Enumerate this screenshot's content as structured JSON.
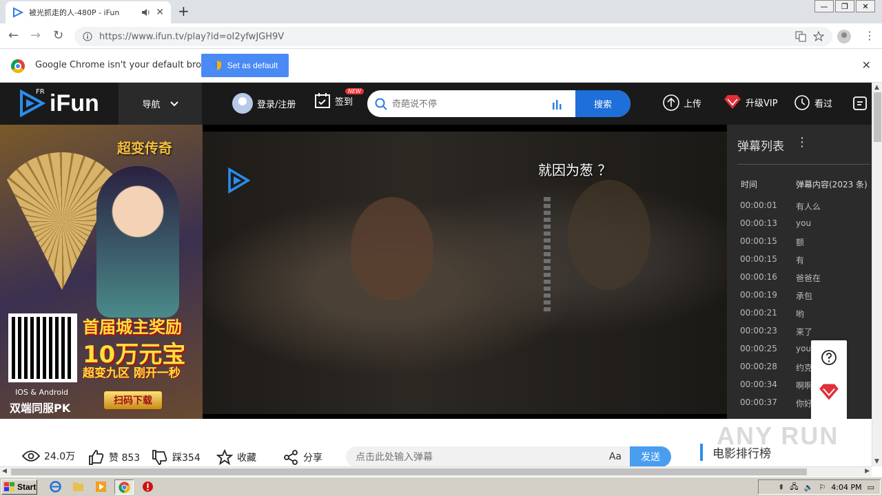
{
  "browser": {
    "tab_title": "被光抓走的人-480P - iFun",
    "tab_close": "✕",
    "new_tab": "+",
    "url": "https://www.ifun.tv/play?id=oI2yfwJGH9V",
    "win_min": "—",
    "win_max": "❐",
    "win_close": "✕"
  },
  "infobar": {
    "message": "Google Chrome isn't your default browser",
    "button": "Set as default",
    "close": "✕"
  },
  "header": {
    "logo_text": "iFun",
    "logo_super": "FR",
    "nav": "导航",
    "login": "登录/注册",
    "checkin": "签到",
    "new_badge": "NEW",
    "search_placeholder": "奇葩说不停",
    "search_button": "搜索",
    "upload": "上传",
    "vip": "升级VIP",
    "history": "看过"
  },
  "ad": {
    "game_title": "超变传奇",
    "line1": "首届城主奖励",
    "line2": "10万元宝",
    "line3": "超变九区 刚开一秒",
    "download": "扫码下载",
    "os": "IOS & Android",
    "pk": "双端同服PK"
  },
  "player": {
    "flying_danmu": "就因为葱  ？"
  },
  "danmu_panel": {
    "title": "弹幕列表",
    "col_time": "时间",
    "col_content": "弹幕内容(2023 条)",
    "rows": [
      {
        "time": "00:00:01",
        "text": "有人么"
      },
      {
        "time": "00:00:13",
        "text": "you"
      },
      {
        "time": "00:00:15",
        "text": "额"
      },
      {
        "time": "00:00:15",
        "text": "有"
      },
      {
        "time": "00:00:16",
        "text": "爸爸在"
      },
      {
        "time": "00:00:19",
        "text": "承包"
      },
      {
        "time": "00:00:21",
        "text": "哟"
      },
      {
        "time": "00:00:23",
        "text": "来了"
      },
      {
        "time": "00:00:25",
        "text": "you"
      },
      {
        "time": "00:00:28",
        "text": "约克"
      },
      {
        "time": "00:00:34",
        "text": "啊啊"
      },
      {
        "time": "00:00:37",
        "text": "你好"
      }
    ]
  },
  "stats": {
    "views": "24.0万",
    "likes": "赞 853",
    "dislikes": "踩354",
    "favorite": "收藏",
    "share": "分享"
  },
  "danmu_input": {
    "placeholder": "点击此处输入弹幕",
    "font_btn": "Aa",
    "send": "发送"
  },
  "rank": {
    "title": "电影排行榜"
  },
  "watermark": "ANY RUN",
  "taskbar": {
    "start": "Start",
    "time": "4:04 PM"
  },
  "colors": {
    "accent": "#1e6fd9",
    "header_bg": "#1a1a1a",
    "vip_red": "#e0303a"
  }
}
